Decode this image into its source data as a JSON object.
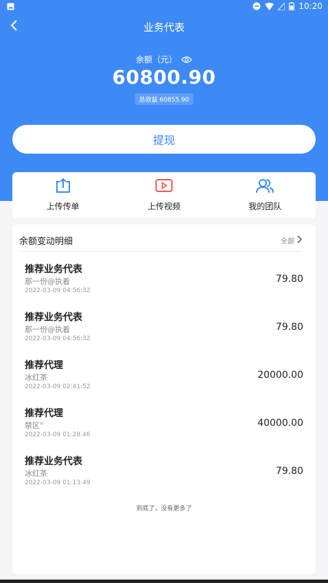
{
  "status_bar": {
    "time": "10:20",
    "icons": [
      "gallery-icon",
      "minus-circle-icon",
      "wifi-icon",
      "sim-off-icon",
      "battery-icon"
    ]
  },
  "nav": {
    "back_icon": "chevron-left-icon",
    "title": "业务代表"
  },
  "balance": {
    "label": "余额（元）",
    "eye_icon": "eye-icon",
    "amount": "60800.90",
    "total_income": "总收益 60855.90"
  },
  "withdraw_label": "提现",
  "actions": [
    {
      "label": "上传传单",
      "icon": "upload-icon"
    },
    {
      "label": "上传视频",
      "icon": "video-play-icon"
    },
    {
      "label": "我的团队",
      "icon": "team-icon"
    }
  ],
  "detail": {
    "title": "余额变动明细",
    "all_label": "全部",
    "records": [
      {
        "type": "推荐业务代表",
        "user": "那一份@执着",
        "time": "2022-03-09 04:56:32",
        "amount": "79.80"
      },
      {
        "type": "推荐业务代表",
        "user": "那一份@执着",
        "time": "2022-03-09 04:56:32",
        "amount": "79.80"
      },
      {
        "type": "推荐代理",
        "user": "冰红茶",
        "time": "2022-03-09 02:41:52",
        "amount": "20000.00"
      },
      {
        "type": "推荐代理",
        "user": "禁区°",
        "time": "2022-03-09 01:28:46",
        "amount": "40000.00"
      },
      {
        "type": "推荐业务代表",
        "user": "冰红茶",
        "time": "2022-03-09 01:13:49",
        "amount": "79.80"
      }
    ],
    "end_text": "到底了，没有更多了"
  },
  "colors": {
    "brand_blue": "#3d8af7",
    "accent_red": "#f0554a",
    "background": "#f5f5f7"
  }
}
